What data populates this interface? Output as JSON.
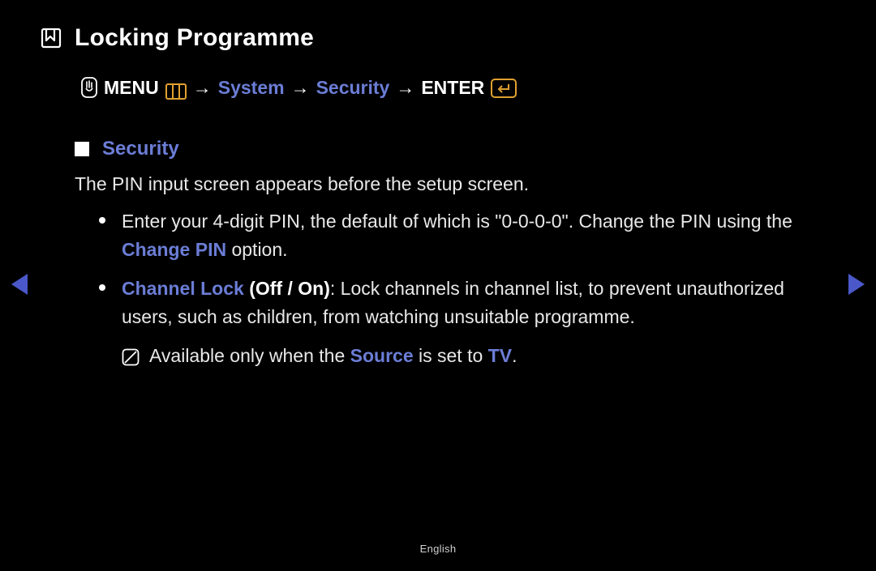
{
  "title": "Locking Programme",
  "breadcrumb": {
    "menu": "MENU",
    "system": "System",
    "security": "Security",
    "enter": "ENTER",
    "arrow": "→"
  },
  "section": {
    "heading": "Security",
    "description": "The PIN input screen appears before the setup screen.",
    "items": [
      {
        "pre": "Enter your 4-digit PIN, the default of which is \"0-0-0-0\". Change the PIN using the ",
        "kw1": "Change PIN",
        "post": " option."
      },
      {
        "kw1": "Channel Lock",
        "paren_open": " (",
        "opt1": "Off",
        "slash": " / ",
        "opt2": "On",
        "paren_close": ")",
        "post": ": Lock channels in channel list, to prevent unauthorized users, such as children, from watching unsuitable programme."
      }
    ],
    "note": {
      "pre": "Available only when the ",
      "kw1": "Source",
      "mid": " is set to ",
      "kw2": "TV",
      "post": "."
    }
  },
  "footer": "English"
}
